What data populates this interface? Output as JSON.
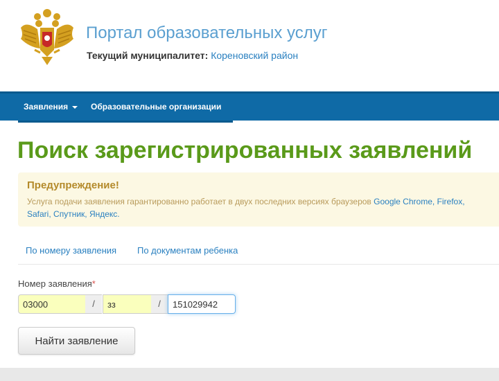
{
  "header": {
    "portal_title": "Портал образовательных услуг",
    "municipality_label": "Текущий муниципалитет:",
    "municipality_value": "Кореновский район",
    "emblem_icon": "russian-coat-of-arms-icon"
  },
  "navbar": {
    "items": [
      {
        "label": "Заявления",
        "has_dropdown": true
      },
      {
        "label": "Образовательные организации",
        "has_dropdown": false
      }
    ]
  },
  "page": {
    "title": "Поиск зарегистрированных заявлений"
  },
  "warning": {
    "title": "Предупреждение!",
    "text": "Услуга подачи заявления гарантированно работает в двух последних версиях браузеров",
    "browsers": [
      "Google Chrome",
      "Firefox",
      "Safari",
      "Спутник",
      "Яндекс"
    ],
    "browser_1": "Google Chrome,",
    "browser_2": "Firefox,",
    "browser_3": "Safari,",
    "browser_4": "Спутник,",
    "browser_5": "Яндекс."
  },
  "tabs": [
    {
      "label": "По номеру заявления",
      "active": true
    },
    {
      "label": "По документам ребенка",
      "active": false
    }
  ],
  "form": {
    "field_label": "Номер заявления",
    "required_mark": "*",
    "part1_value": "03000",
    "separator": "/",
    "part2_value": "зз",
    "part3_value": "151029942",
    "submit_label": "Найти заявление"
  },
  "colors": {
    "title_green": "#5a9a1a",
    "nav_blue": "#0f6aa6",
    "link_blue": "#2a80c0",
    "warning_bg": "#fcf8e3"
  }
}
